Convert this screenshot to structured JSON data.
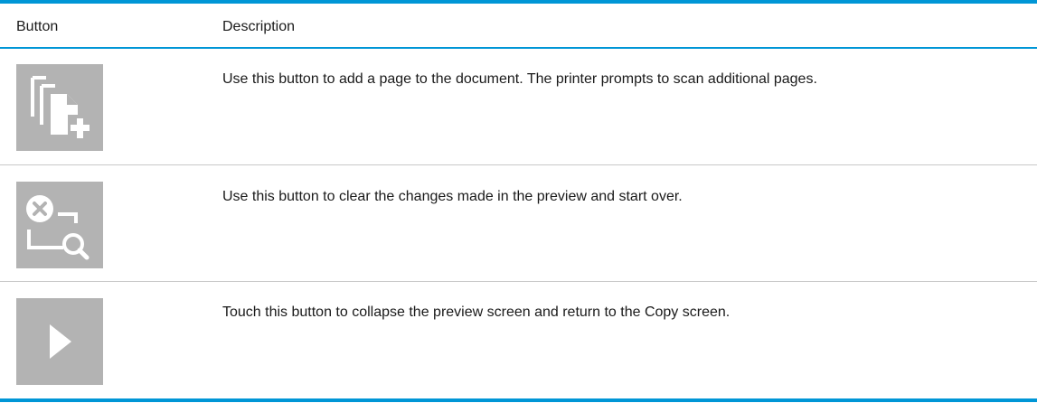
{
  "table": {
    "headers": {
      "button": "Button",
      "description": "Description"
    },
    "rows": [
      {
        "icon": "add-page-icon",
        "description": "Use this button to add a page to the document. The printer prompts to scan additional pages."
      },
      {
        "icon": "clear-preview-icon",
        "description": "Use this button to clear the changes made in the preview and start over."
      },
      {
        "icon": "collapse-preview-icon",
        "description": "Touch this button to collapse the preview screen and return to the Copy screen."
      }
    ]
  },
  "colors": {
    "accent_rule": "#0096d6",
    "icon_tile": "#b3b3b3",
    "icon_glyph": "#ffffff"
  }
}
